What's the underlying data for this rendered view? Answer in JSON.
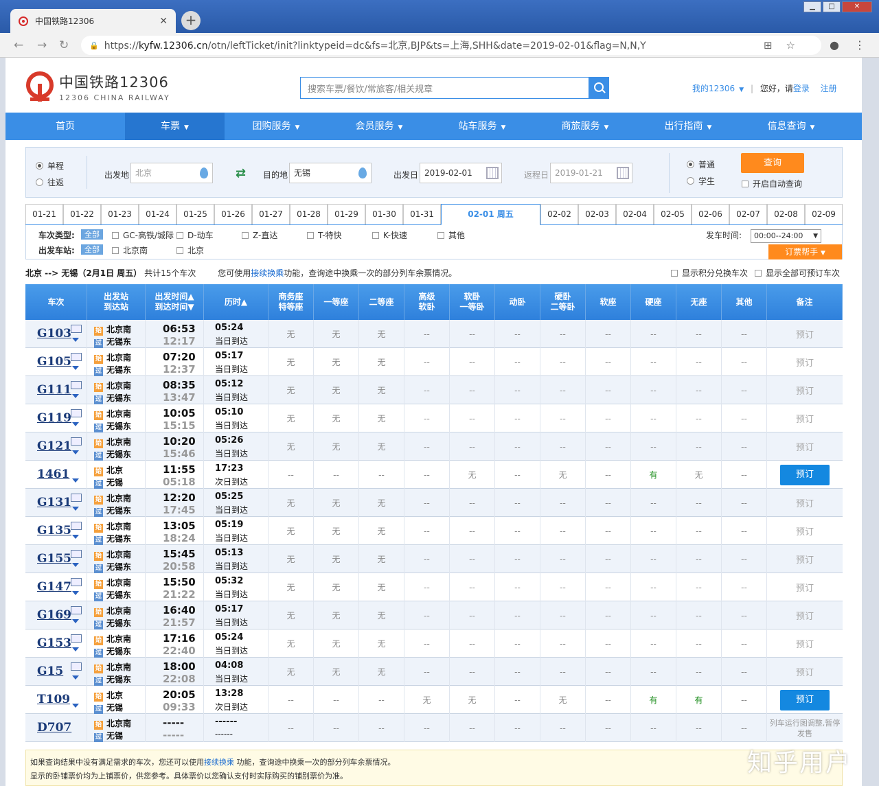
{
  "browser": {
    "tab_title": "中国铁路12306",
    "tab_close": "✕",
    "new_tab": "+",
    "url_domain": "kyfw.12306.cn",
    "url_prefix": "https://",
    "url_path": "/otn/leftTicket/init?linktypeid=dc&fs=北京,BJP&ts=上海,SHH&date=2019-02-01&flag=N,N,Y"
  },
  "header": {
    "logo_cn": "中国铁路12306",
    "logo_en": "12306 CHINA RAILWAY",
    "search_placeholder": "搜索车票/餐饮/常旅客/相关规章",
    "my12306": "我的12306",
    "greeting": "您好，请",
    "login": "登录",
    "register": "注册"
  },
  "nav": [
    "首页",
    "车票",
    "团购服务",
    "会员服务",
    "站车服务",
    "商旅服务",
    "出行指南",
    "信息查询"
  ],
  "query": {
    "one_way": "单程",
    "round_trip": "往返",
    "from_label": "出发地",
    "from_value": "北京",
    "to_label": "目的地",
    "to_value": "无锡",
    "depart_label": "出发日",
    "depart_value": "2019-02-01",
    "return_label": "返程日",
    "return_value": "2019-01-21",
    "normal": "普通",
    "student": "学生",
    "query_btn": "查询",
    "auto_query": "开启自动查询"
  },
  "dates": [
    "01-21",
    "01-22",
    "01-23",
    "01-24",
    "01-25",
    "01-26",
    "01-27",
    "01-28",
    "01-29",
    "01-30",
    "01-31",
    "02-01 周五",
    "02-02",
    "02-03",
    "02-04",
    "02-05",
    "02-06",
    "02-07",
    "02-08",
    "02-09"
  ],
  "filter": {
    "type_label": "车次类型:",
    "all": "全部",
    "types": [
      "GC-高铁/城际",
      "D-动车",
      "Z-直达",
      "T-特快",
      "K-快速",
      "其他"
    ],
    "station_label": "出发车站:",
    "stations": [
      "北京南",
      "北京"
    ],
    "time_label": "发车时间:",
    "time_value": "00:00--24:00",
    "help": "订票帮手"
  },
  "summary": {
    "route": "北京 --> 无锡（2月1日  周五）",
    "count": "共计15个车次",
    "tip_pre": "您可使用",
    "tip_link": "接续换乘",
    "tip_post": "功能，查询途中换乘一次的部分列车余票情况。",
    "opt1": "显示积分兑换车次",
    "opt2": "显示全部可预订车次"
  },
  "columns": [
    "车次",
    "出发站\n到达站",
    "出发时间▲\n到达时间▼",
    "历时▲",
    "商务座\n特等座",
    "一等座",
    "二等座",
    "高级\n软卧",
    "软卧\n一等卧",
    "动卧",
    "硬卧\n二等卧",
    "软座",
    "硬座",
    "无座",
    "其他",
    "备注"
  ],
  "trains": [
    {
      "no": "G103",
      "from": "北京南",
      "to": "无锡东",
      "dep": "06:53",
      "arr": "12:17",
      "dur": "05:24",
      "day": "当日到达",
      "seats": [
        "无",
        "无",
        "无",
        "--",
        "--",
        "--",
        "--",
        "--",
        "--",
        "--",
        "--"
      ],
      "book": "预订",
      "bookable": false
    },
    {
      "no": "G105",
      "from": "北京南",
      "to": "无锡东",
      "dep": "07:20",
      "arr": "12:37",
      "dur": "05:17",
      "day": "当日到达",
      "seats": [
        "无",
        "无",
        "无",
        "--",
        "--",
        "--",
        "--",
        "--",
        "--",
        "--",
        "--"
      ],
      "book": "预订",
      "bookable": false
    },
    {
      "no": "G111",
      "from": "北京南",
      "to": "无锡东",
      "dep": "08:35",
      "arr": "13:47",
      "dur": "05:12",
      "day": "当日到达",
      "seats": [
        "无",
        "无",
        "无",
        "--",
        "--",
        "--",
        "--",
        "--",
        "--",
        "--",
        "--"
      ],
      "book": "预订",
      "bookable": false
    },
    {
      "no": "G119",
      "from": "北京南",
      "to": "无锡东",
      "dep": "10:05",
      "arr": "15:15",
      "dur": "05:10",
      "day": "当日到达",
      "seats": [
        "无",
        "无",
        "无",
        "--",
        "--",
        "--",
        "--",
        "--",
        "--",
        "--",
        "--"
      ],
      "book": "预订",
      "bookable": false
    },
    {
      "no": "G121",
      "from": "北京南",
      "to": "无锡东",
      "dep": "10:20",
      "arr": "15:46",
      "dur": "05:26",
      "day": "当日到达",
      "seats": [
        "无",
        "无",
        "无",
        "--",
        "--",
        "--",
        "--",
        "--",
        "--",
        "--",
        "--"
      ],
      "book": "预订",
      "bookable": false
    },
    {
      "no": "1461",
      "from": "北京",
      "to": "无锡",
      "dep": "11:55",
      "arr": "05:18",
      "dur": "17:23",
      "day": "次日到达",
      "seats": [
        "--",
        "--",
        "--",
        "--",
        "无",
        "--",
        "无",
        "--",
        "有",
        "无",
        "--"
      ],
      "book": "预订",
      "bookable": true
    },
    {
      "no": "G131",
      "from": "北京南",
      "to": "无锡东",
      "dep": "12:20",
      "arr": "17:45",
      "dur": "05:25",
      "day": "当日到达",
      "seats": [
        "无",
        "无",
        "无",
        "--",
        "--",
        "--",
        "--",
        "--",
        "--",
        "--",
        "--"
      ],
      "book": "预订",
      "bookable": false
    },
    {
      "no": "G135",
      "from": "北京南",
      "to": "无锡东",
      "dep": "13:05",
      "arr": "18:24",
      "dur": "05:19",
      "day": "当日到达",
      "seats": [
        "无",
        "无",
        "无",
        "--",
        "--",
        "--",
        "--",
        "--",
        "--",
        "--",
        "--"
      ],
      "book": "预订",
      "bookable": false
    },
    {
      "no": "G155",
      "from": "北京南",
      "to": "无锡东",
      "dep": "15:45",
      "arr": "20:58",
      "dur": "05:13",
      "day": "当日到达",
      "seats": [
        "无",
        "无",
        "无",
        "--",
        "--",
        "--",
        "--",
        "--",
        "--",
        "--",
        "--"
      ],
      "book": "预订",
      "bookable": false
    },
    {
      "no": "G147",
      "from": "北京南",
      "to": "无锡东",
      "dep": "15:50",
      "arr": "21:22",
      "dur": "05:32",
      "day": "当日到达",
      "seats": [
        "无",
        "无",
        "无",
        "--",
        "--",
        "--",
        "--",
        "--",
        "--",
        "--",
        "--"
      ],
      "book": "预订",
      "bookable": false
    },
    {
      "no": "G169",
      "from": "北京南",
      "to": "无锡东",
      "dep": "16:40",
      "arr": "21:57",
      "dur": "05:17",
      "day": "当日到达",
      "seats": [
        "无",
        "无",
        "无",
        "--",
        "--",
        "--",
        "--",
        "--",
        "--",
        "--",
        "--"
      ],
      "book": "预订",
      "bookable": false
    },
    {
      "no": "G153",
      "from": "北京南",
      "to": "无锡东",
      "dep": "17:16",
      "arr": "22:40",
      "dur": "05:24",
      "day": "当日到达",
      "seats": [
        "无",
        "无",
        "无",
        "--",
        "--",
        "--",
        "--",
        "--",
        "--",
        "--",
        "--"
      ],
      "book": "预订",
      "bookable": false
    },
    {
      "no": "G15",
      "from": "北京南",
      "to": "无锡东",
      "dep": "18:00",
      "arr": "22:08",
      "dur": "04:08",
      "day": "当日到达",
      "seats": [
        "无",
        "无",
        "无",
        "--",
        "--",
        "--",
        "--",
        "--",
        "--",
        "--",
        "--"
      ],
      "book": "预订",
      "bookable": false
    },
    {
      "no": "T109",
      "from": "北京",
      "to": "无锡",
      "dep": "20:05",
      "arr": "09:33",
      "dur": "13:28",
      "day": "次日到达",
      "seats": [
        "--",
        "--",
        "--",
        "无",
        "无",
        "--",
        "无",
        "--",
        "有",
        "有",
        "--"
      ],
      "book": "预订",
      "bookable": true
    },
    {
      "no": "D707",
      "from": "北京南",
      "to": "无锡",
      "dep": "-----",
      "arr": "-----",
      "dur": "------",
      "day": "------",
      "seats": [
        "--",
        "--",
        "--",
        "--",
        "--",
        "--",
        "--",
        "--",
        "--",
        "--",
        "--"
      ],
      "book": "列车运行图调整,暂停发售",
      "bookable": false
    }
  ],
  "footer": {
    "line1_pre": "如果查询结果中没有满足需求的车次，您还可以使用",
    "line1_link": "接续换乘",
    "line1_post": " 功能，查询途中换乘一次的部分列车余票情况。",
    "line2": "显示的卧铺票价均为上铺票价，供您参考。具体票价以您确认支付时实际购买的铺别票价为准。"
  },
  "watermark": "知乎用户"
}
